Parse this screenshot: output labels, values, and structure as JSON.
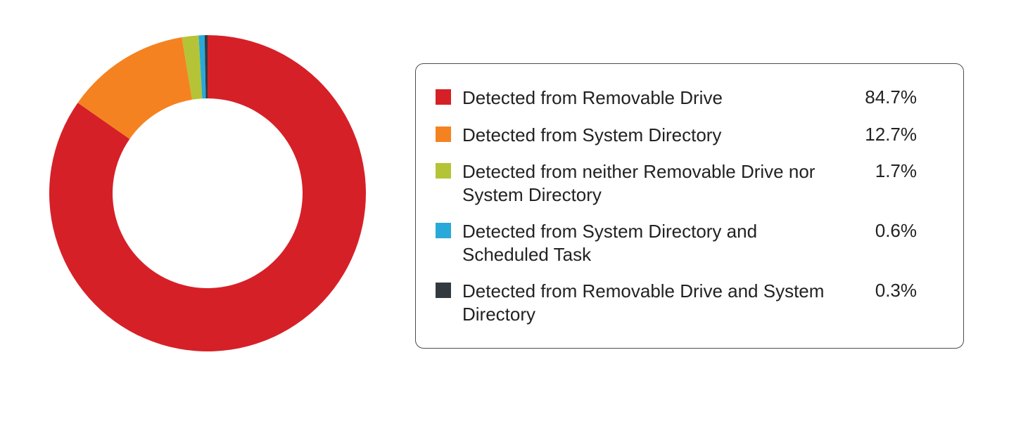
{
  "chart_data": {
    "type": "pie",
    "title": "",
    "series": [
      {
        "name": "Detected from Removable Drive",
        "value": 84.7,
        "percent_label": "84.7%",
        "color": "#d62027"
      },
      {
        "name": "Detected from System Directory",
        "value": 12.7,
        "percent_label": "12.7%",
        "color": "#f58220"
      },
      {
        "name": "Detected from neither Removable Drive nor System Directory",
        "value": 1.7,
        "percent_label": "1.7%",
        "color": "#b4c436"
      },
      {
        "name": "Detected from System Directory and Scheduled Task",
        "value": 0.6,
        "percent_label": "0.6%",
        "color": "#29a9d9"
      },
      {
        "name": "Detected from Removable Drive and System Directory",
        "value": 0.3,
        "percent_label": "0.3%",
        "color": "#323a40"
      }
    ]
  }
}
